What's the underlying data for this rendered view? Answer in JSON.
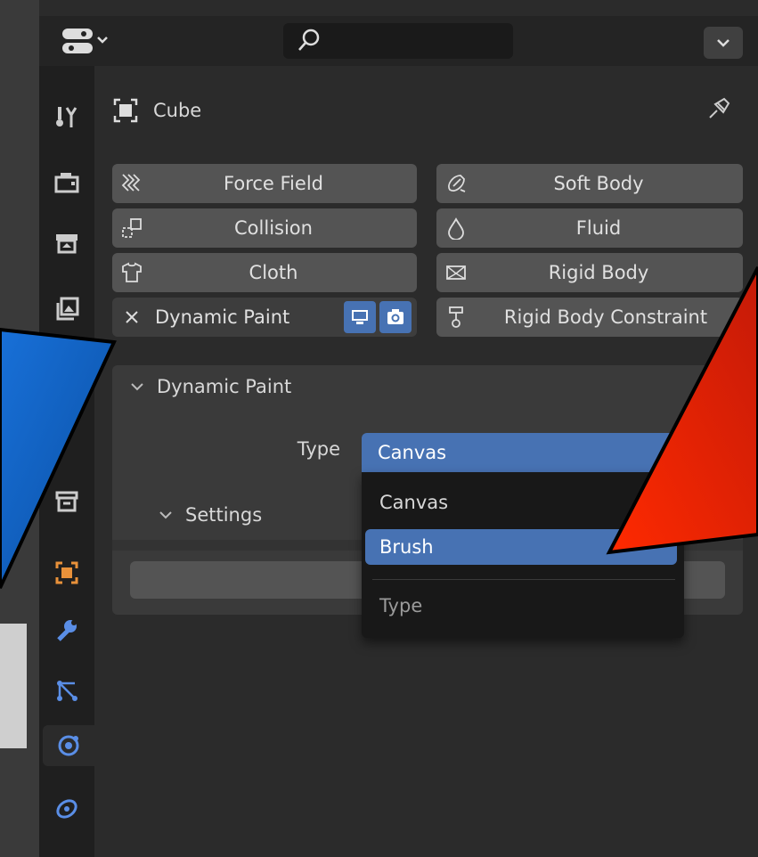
{
  "header": {
    "search_placeholder": ""
  },
  "object": {
    "name": "Cube"
  },
  "physics_buttons": [
    {
      "label": "Force Field",
      "icon": "force-field-icon"
    },
    {
      "label": "Soft Body",
      "icon": "soft-body-icon"
    },
    {
      "label": "Collision",
      "icon": "collision-icon"
    },
    {
      "label": "Fluid",
      "icon": "fluid-icon"
    },
    {
      "label": "Cloth",
      "icon": "cloth-icon"
    },
    {
      "label": "Rigid Body",
      "icon": "rigid-body-icon"
    },
    {
      "label": "Dynamic Paint",
      "icon": "close-icon"
    },
    {
      "label": "Rigid Body Constraint",
      "icon": "rigid-body-constraint-icon"
    }
  ],
  "panel": {
    "title": "Dynamic Paint",
    "type_label": "Type",
    "type_value": "Canvas",
    "settings_title": "Settings"
  },
  "dropdown": {
    "options": [
      "Canvas",
      "Brush"
    ],
    "selected": "Brush",
    "title": "Type"
  },
  "colors": {
    "accent": "#4772b3",
    "arrow_blue": "#0a5ab8",
    "arrow_red": "#e62a10"
  }
}
